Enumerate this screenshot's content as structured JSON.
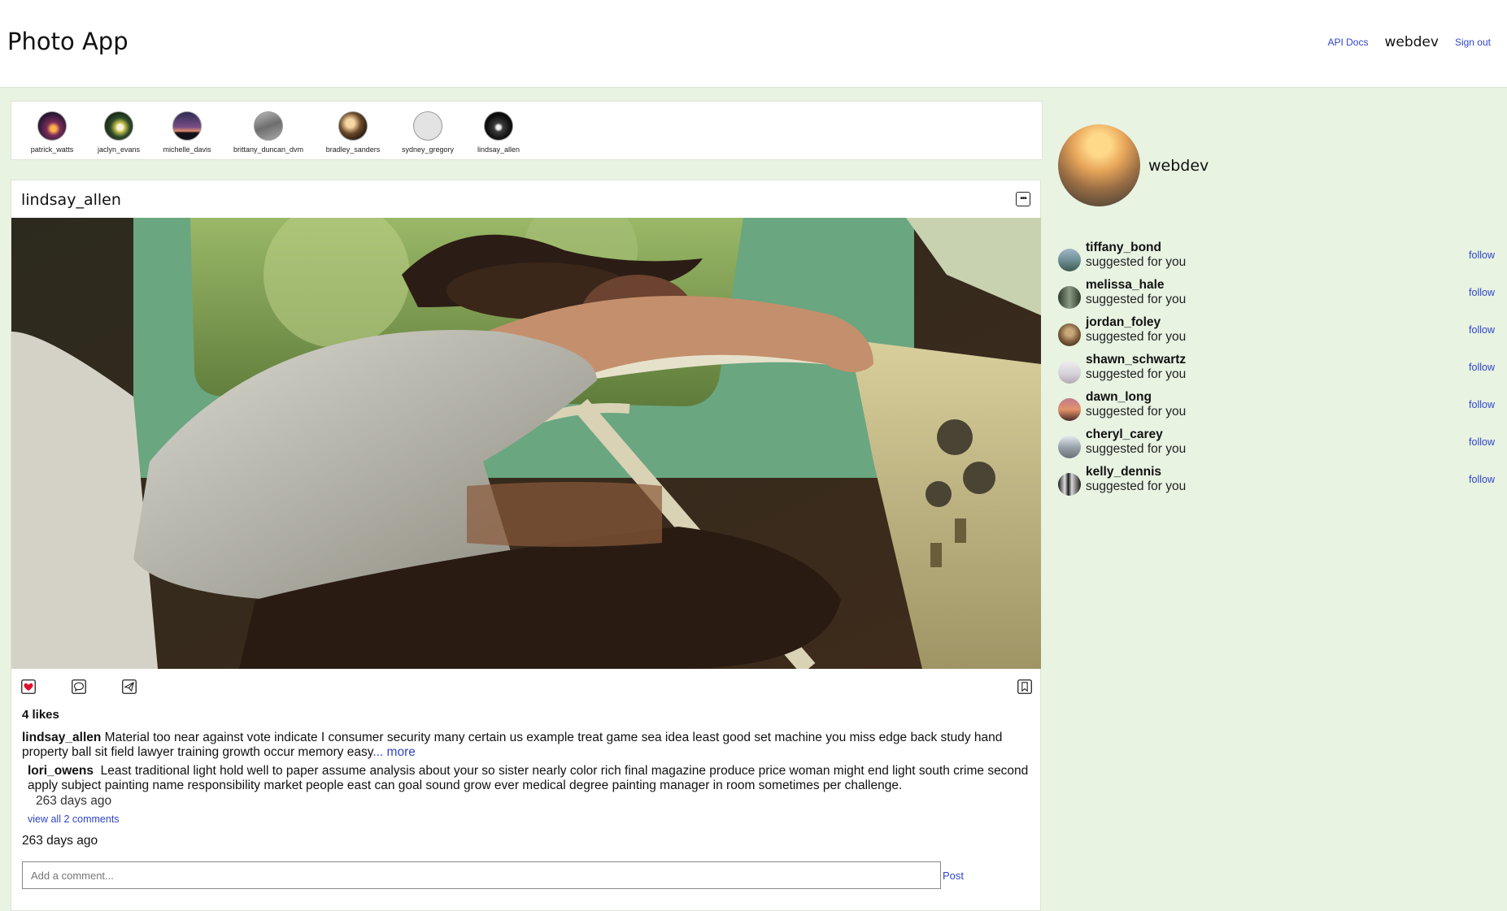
{
  "header": {
    "title": "Photo App",
    "api_docs": "API Docs",
    "username": "webdev",
    "sign_out": "Sign out"
  },
  "stories": [
    {
      "name": "patrick_watts"
    },
    {
      "name": "jaclyn_evans"
    },
    {
      "name": "michelle_davis"
    },
    {
      "name": "brittany_duncan_dvm"
    },
    {
      "name": "bradley_sanders"
    },
    {
      "name": "sydney_gregory"
    },
    {
      "name": "lindsay_allen"
    }
  ],
  "post": {
    "username": "lindsay_allen",
    "likes": "4 likes",
    "caption_user": "lindsay_allen",
    "caption_text": "Material too near against vote indicate I consumer security many certain us example treat game sea idea least good set machine you miss edge back study hand property ball sit field lawyer training growth occur memory easy",
    "caption_more": "... more",
    "comment_user": "lori_owens",
    "comment_text": "Least traditional light hold well to paper assume analysis about your so sister nearly color rich final magazine produce price woman might end light south crime second apply subject painting name responsibility market people east can goal sound grow ever medical degree painting manager in room sometimes per challenge.",
    "comment_time": "263 days ago",
    "view_all": "view all 2 comments",
    "time": "263 days ago",
    "comment_placeholder": "Add a comment...",
    "post_button": "Post",
    "liked": true
  },
  "profile": {
    "username": "webdev"
  },
  "suggestions": [
    {
      "name": "tiffany_bond",
      "subtitle": "suggested for you",
      "action": "follow"
    },
    {
      "name": "melissa_hale",
      "subtitle": "suggested for you",
      "action": "follow"
    },
    {
      "name": "jordan_foley",
      "subtitle": "suggested for you",
      "action": "follow"
    },
    {
      "name": "shawn_schwartz",
      "subtitle": "suggested for you",
      "action": "follow"
    },
    {
      "name": "dawn_long",
      "subtitle": "suggested for you",
      "action": "follow"
    },
    {
      "name": "cheryl_carey",
      "subtitle": "suggested for you",
      "action": "follow"
    },
    {
      "name": "kelly_dennis",
      "subtitle": "suggested for you",
      "action": "follow"
    }
  ],
  "colors": {
    "page_bg": "#e8f3e2",
    "link": "#2f45c9",
    "like": "#e0102a"
  }
}
